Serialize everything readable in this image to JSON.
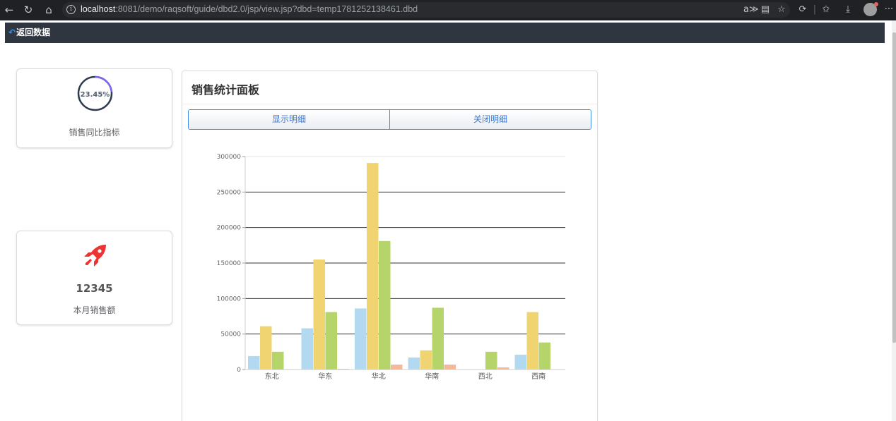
{
  "browser": {
    "url_host": "localhost",
    "url_rest": ":8081/demo/raqsoft/guide/dbd2.0/jsp/view.jsp?dbd=temp1781252138461.dbd"
  },
  "topnav": {
    "back_label": "返回数据"
  },
  "kpi_yoy": {
    "percent_text": "23.45%",
    "percent_value": 23.45,
    "caption": "销售同比指标",
    "ring_color": "#7b68ee",
    "track_color": "#2f3b4e"
  },
  "kpi_month": {
    "value": "12345",
    "caption": "本月销售额",
    "icon": "rocket-icon",
    "icon_color": "#ee3333"
  },
  "panel": {
    "title": "销售统计面板",
    "buttons": [
      "显示明细",
      "关闭明细"
    ]
  },
  "chart_data": {
    "type": "bar",
    "categories": [
      "东北",
      "华东",
      "华北",
      "华南",
      "西北",
      "西南"
    ],
    "series": [
      {
        "color": "#b3d9f0",
        "values": [
          19000,
          58000,
          86000,
          17000,
          0,
          21000
        ]
      },
      {
        "color": "#f0d472",
        "values": [
          61000,
          155000,
          291000,
          27000,
          0,
          81000
        ]
      },
      {
        "color": "#b5d46a",
        "values": [
          25000,
          81000,
          181000,
          87000,
          25000,
          38000
        ]
      },
      {
        "color": "#f5b99a",
        "values": [
          500,
          1000,
          7000,
          7000,
          3000,
          0
        ]
      }
    ],
    "yticks": [
      0,
      50000,
      100000,
      150000,
      200000,
      250000,
      300000
    ],
    "ylim": [
      0,
      300000
    ],
    "grid": true
  }
}
